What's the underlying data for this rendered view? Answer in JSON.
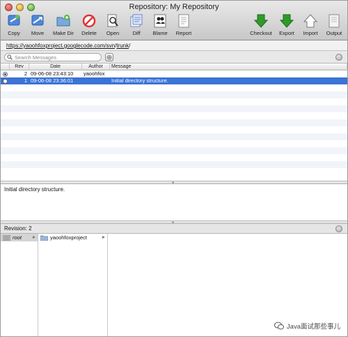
{
  "window": {
    "title": "Repository: My Repository"
  },
  "toolbar": {
    "left": [
      {
        "label": "Copy",
        "icon": "copy-icon"
      },
      {
        "label": "Move",
        "icon": "move-icon"
      },
      {
        "label": "Make Dir",
        "icon": "make-dir-icon"
      },
      {
        "label": "Delete",
        "icon": "delete-icon"
      },
      {
        "label": "Open",
        "icon": "open-icon"
      },
      {
        "label": "Diff",
        "icon": "diff-icon"
      },
      {
        "label": "Blame",
        "icon": "blame-icon"
      },
      {
        "label": "Report",
        "icon": "report-icon"
      }
    ],
    "right": [
      {
        "label": "Checkout",
        "icon": "checkout-icon"
      },
      {
        "label": "Export",
        "icon": "export-icon"
      },
      {
        "label": "Import",
        "icon": "import-icon"
      },
      {
        "label": "Output",
        "icon": "output-icon"
      }
    ]
  },
  "url": {
    "base": "https://yaoohfoxproject.googlecode.com/svn",
    "sep1": "/",
    "path": "trunk",
    "sep2": "/"
  },
  "search": {
    "placeholder": "Search Messages"
  },
  "table": {
    "headers": {
      "rev": "Rev",
      "date": "Date",
      "author": "Author",
      "message": "Message"
    },
    "rows": [
      {
        "rev": "2",
        "date": "09-06-08 23:43:10",
        "author": "yaoohfox",
        "message": ""
      },
      {
        "rev": "1",
        "date": "09-06-08 23:36:01",
        "author": "",
        "message": "Initial directory structure."
      }
    ]
  },
  "message_pane": {
    "text": "Initial directory structure."
  },
  "revision": {
    "label": "Revision:",
    "value": "2"
  },
  "browser": {
    "col1": [
      {
        "label": "root"
      }
    ],
    "col2": [
      {
        "label": "yaoohfoxproject"
      }
    ]
  },
  "watermark": {
    "text": "Java面试那些事儿"
  },
  "colors": {
    "selection": "#3b73d6",
    "stripe": "#f1f5fa",
    "toolbar_green": "#2f9a2a"
  }
}
